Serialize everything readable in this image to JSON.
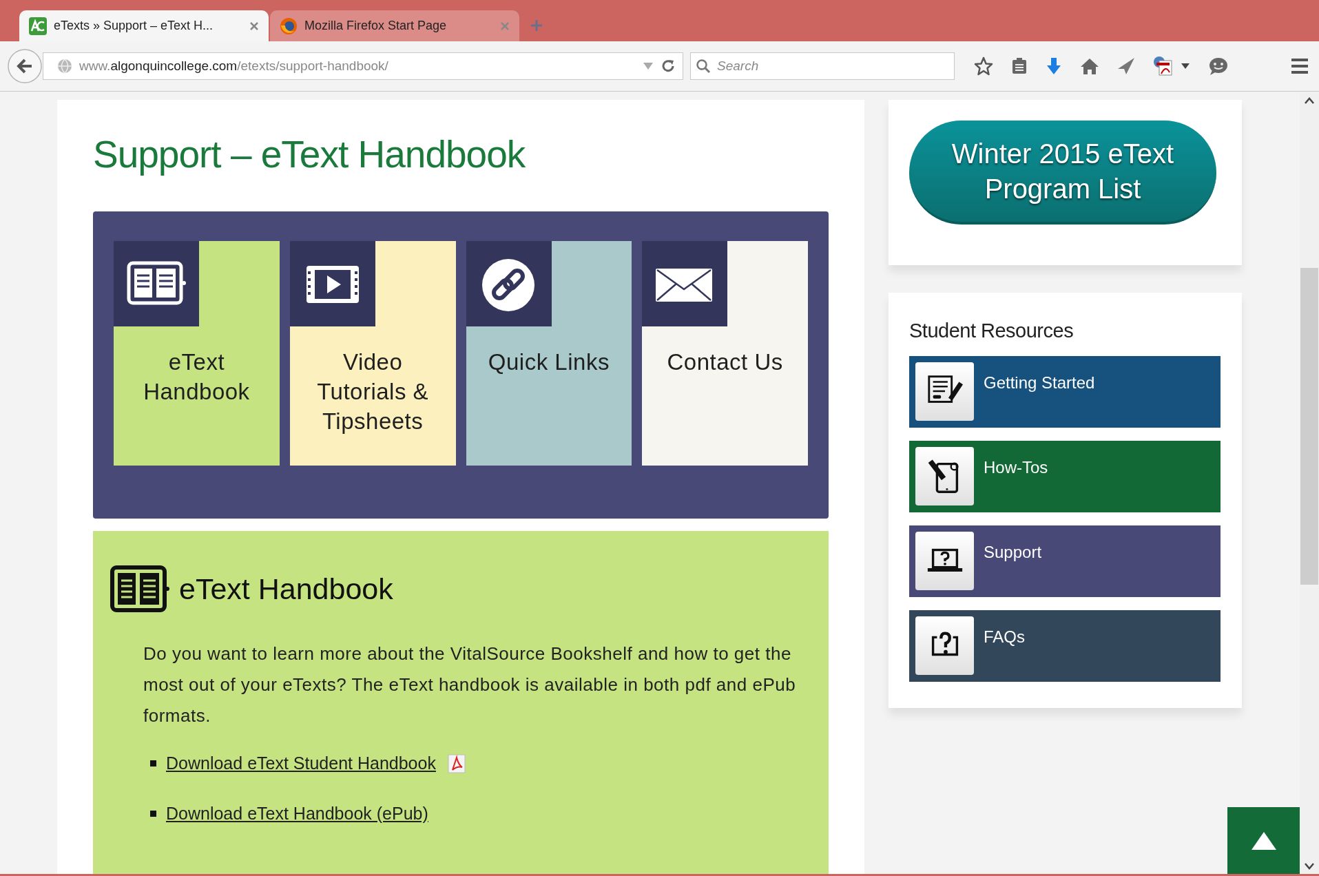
{
  "browser": {
    "tabs": [
      {
        "title": "eTexts » Support – eText H...",
        "selected": true,
        "kind": "site"
      },
      {
        "title": "Mozilla Firefox Start Page",
        "selected": false,
        "kind": "globe"
      }
    ],
    "address": {
      "prefix": "www.",
      "domain": "algonquincollege.com",
      "path": "/etexts/support-handbook/"
    },
    "search": {
      "placeholder": "Search"
    }
  },
  "page": {
    "title": "Support – eText Handbook",
    "tiles": [
      {
        "label": "eText Handbook",
        "color": "#c5e381",
        "kind": "book"
      },
      {
        "label": "Video Tutorials & Tipsheets",
        "color": "#fdf0bf",
        "kind": "video"
      },
      {
        "label": "Quick Links",
        "color": "#aac9cb",
        "kind": "link"
      },
      {
        "label": "Contact Us",
        "color": "#f7f5ef",
        "kind": "mail"
      }
    ],
    "section": {
      "title": "eText Handbook",
      "text": "Do you want to learn more about the VitalSource Bookshelf and how to get the most out of your eTexts? The eText handbook is available in both pdf and ePub formats.",
      "links": [
        {
          "text": "Download eText Student Handbook",
          "pdf": true
        },
        {
          "text": "Download eText Handbook (ePub)",
          "pdf": false
        }
      ]
    }
  },
  "sidebar": {
    "program_button": "Winter 2015 eText Program List",
    "resources_title": "Student Resources",
    "resources": [
      {
        "label": "Getting Started",
        "color": "#17517e",
        "kind": "form"
      },
      {
        "label": "How-Tos",
        "color": "#126935",
        "kind": "tablet"
      },
      {
        "label": "Support",
        "color": "#484976",
        "kind": "laptop"
      },
      {
        "label": "FAQs",
        "color": "#33475b",
        "kind": "question"
      }
    ]
  }
}
